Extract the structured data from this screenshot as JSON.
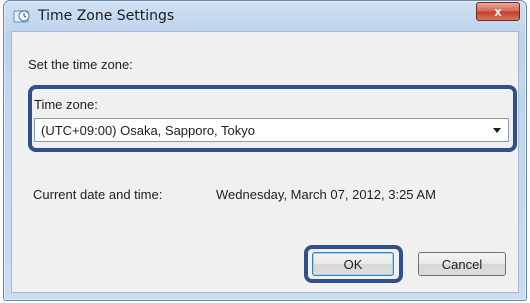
{
  "window": {
    "title": "Time Zone Settings",
    "close_label": "x"
  },
  "dialog": {
    "heading": "Set the time zone:",
    "timezone_label": "Time zone:",
    "timezone_value": "(UTC+09:00) Osaka, Sapporo, Tokyo",
    "current_label": "Current date and time:",
    "current_value": "Wednesday, March 07, 2012, 3:25 AM",
    "ok_label": "OK",
    "cancel_label": "Cancel"
  },
  "colors": {
    "highlight": "#2f4f8f",
    "frame": "#bed4ed",
    "close_button": "#c0422b"
  },
  "icons": {
    "app": "clock-globe-icon",
    "dropdown": "chevron-down-icon"
  }
}
